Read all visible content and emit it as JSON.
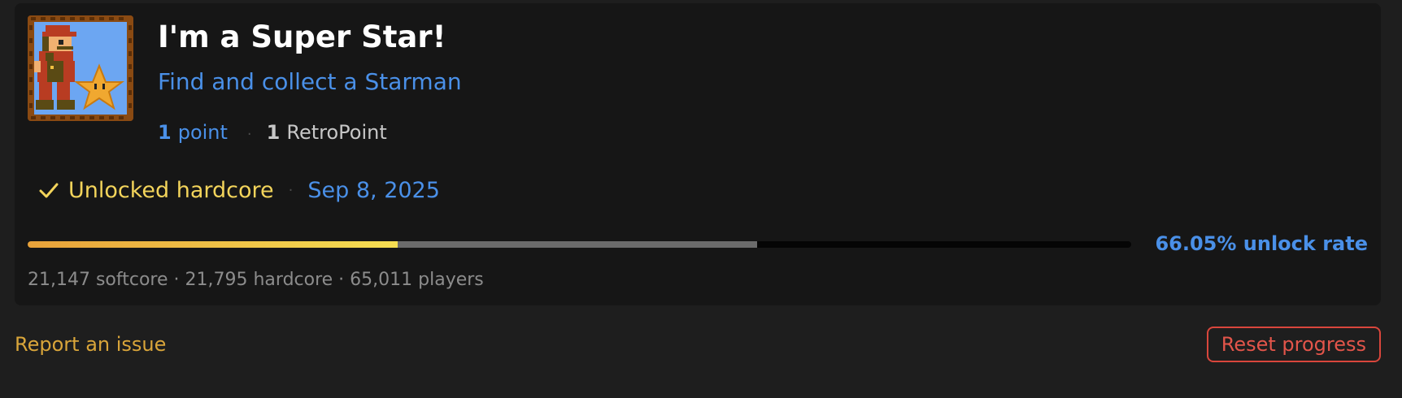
{
  "achievement": {
    "title": "I'm a Super Star!",
    "description": "Find and collect a Starman",
    "points_value": "1",
    "points_label": "point",
    "retropoints_value": "1",
    "retropoints_label": "RetroPoint",
    "separator": "·",
    "badge_icon": "mario-starman-badge-icon"
  },
  "unlock": {
    "icon": "check-icon",
    "status": "Unlocked hardcore",
    "separator": "·",
    "date": "Sep 8, 2025"
  },
  "progress": {
    "hardcore_fraction": 0.335,
    "total_fraction": 0.661,
    "rate_text": "66.05% unlock rate"
  },
  "stats": {
    "text": "21,147 softcore · 21,795 hardcore · 65,011 players"
  },
  "footer": {
    "report_label": "Report an issue",
    "reset_label": "Reset progress"
  },
  "colors": {
    "accent_blue": "#4a90e8",
    "unlock_yellow": "#f3d45b",
    "danger_red": "#d9463c",
    "link_gold": "#d9a53a"
  }
}
